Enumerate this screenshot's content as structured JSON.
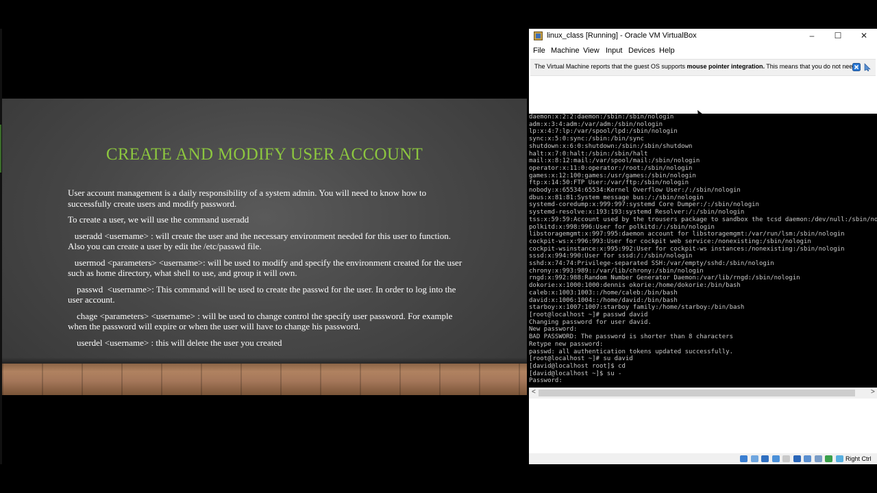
{
  "slide": {
    "title": "CREATE AND MODIFY USER ACCOUNT",
    "paragraphs": [
      "User account management is a daily responsibility of a system admin. You will need to know how to successfully create users and modify password.",
      "To create a user, we will use the command useradd",
      "   useradd <username> : will create the user and the necessary environment needed for this user to function. Also you can create a user by edit the /etc/passwd file.",
      "   usermod <parameters> <username>: will be used to modify and specify the environment created for the user such as home directory, what shell to use, and group it will own.",
      "    passwd  <username>: This command will be used to create the passwd for the user. In order to log into the user account.",
      "    chage <parameters> <username> : will be used to change control the specify user password. For example when the password will expire or when the user will have to change his password.",
      "    userdel <username> : this will delete the user you created"
    ],
    "colors": {
      "title": "#8cc63f",
      "background": "#484848"
    }
  },
  "vbox": {
    "title": "linux_class [Running] - Oracle VM VirtualBox",
    "controls": {
      "minimize": "–",
      "maximize": "☐",
      "close": "✕"
    },
    "menu": [
      "File",
      "Machine",
      "View",
      "Input",
      "Devices",
      "Help"
    ],
    "notice": {
      "text_before": "The Virtual Machine reports that the guest OS supports ",
      "bold": "mouse pointer integration.",
      "text_after": " This means that you do not need"
    },
    "terminal_lines": [
      "daemon:x:2:2:daemon:/sbin:/sbin/nologin",
      "adm:x:3:4:adm:/var/adm:/sbin/nologin",
      "lp:x:4:7:lp:/var/spool/lpd:/sbin/nologin",
      "sync:x:5:0:sync:/sbin:/bin/sync",
      "shutdown:x:6:0:shutdown:/sbin:/sbin/shutdown",
      "halt:x:7:0:halt:/sbin:/sbin/halt",
      "mail:x:8:12:mail:/var/spool/mail:/sbin/nologin",
      "operator:x:11:0:operator:/root:/sbin/nologin",
      "games:x:12:100:games:/usr/games:/sbin/nologin",
      "ftp:x:14:50:FTP User:/var/ftp:/sbin/nologin",
      "nobody:x:65534:65534:Kernel Overflow User:/:/sbin/nologin",
      "dbus:x:81:81:System message bus:/:/sbin/nologin",
      "systemd-coredump:x:999:997:systemd Core Dumper:/:/sbin/nologin",
      "systemd-resolve:x:193:193:systemd Resolver:/:/sbin/nologin",
      "tss:x:59:59:Account used by the trousers package to sandbox the tcsd daemon:/dev/null:/sbin/nol",
      "polkitd:x:998:996:User for polkitd:/:/sbin/nologin",
      "libstoragemgmt:x:997:995:daemon account for libstoragemgmt:/var/run/lsm:/sbin/nologin",
      "cockpit-ws:x:996:993:User for cockpit web service:/nonexisting:/sbin/nologin",
      "cockpit-wsinstance:x:995:992:User for cockpit-ws instances:/nonexisting:/sbin/nologin",
      "sssd:x:994:990:User for sssd:/:/sbin/nologin",
      "sshd:x:74:74:Privilege-separated SSH:/var/empty/sshd:/sbin/nologin",
      "chrony:x:993:989::/var/lib/chrony:/sbin/nologin",
      "rngd:x:992:988:Random Number Generator Daemon:/var/lib/rngd:/sbin/nologin",
      "dokorie:x:1000:1000:dennis okorie:/home/dokorie:/bin/bash",
      "caleb:x:1003:1003::/home/caleb:/bin/bash",
      "david:x:1006:1004::/home/david:/bin/bash",
      "starboy:x:1007:1007:starboy family:/home/starboy:/bin/bash",
      "[root@localhost ~]# passwd david",
      "Changing password for user david.",
      "New password:",
      "BAD PASSWORD: The password is shorter than 8 characters",
      "Retype new password:",
      "passwd: all authentication tokens updated successfully.",
      "[root@localhost ~]# su david",
      "[david@localhost root]$ cd",
      "[david@localhost ~]$ su -",
      "Password:"
    ],
    "scroll_left": "<",
    "scroll_right": ">",
    "status_icons": [
      "hdd-icon",
      "optical-icon",
      "network-icon",
      "usb-icon",
      "shared-folder-icon",
      "display-icon",
      "video-capture-icon",
      "cpu-icon",
      "mouse-integration-icon",
      "keyboard-icon"
    ],
    "host_key": "Right Ctrl"
  }
}
